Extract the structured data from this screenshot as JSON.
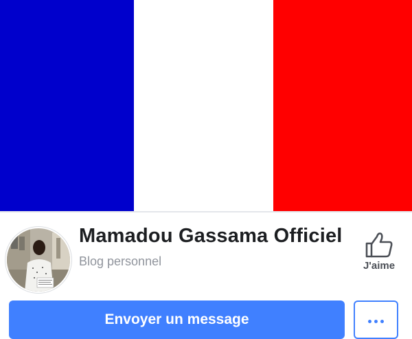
{
  "cover": {
    "colors": {
      "blue": "#0000cc",
      "white": "#ffffff",
      "red": "#ff0000"
    }
  },
  "profile": {
    "name": "Mamadou Gassama Officiel",
    "category": "Blog personnel"
  },
  "actions": {
    "like_label": "J'aime",
    "like_icon": "thumbs-up-icon",
    "message_button_label": "Envoyer un message",
    "more_icon": "more-dots-icon"
  },
  "theme": {
    "accent": "#4080ff",
    "text_primary": "#1c1e21",
    "text_secondary": "#90949c"
  }
}
